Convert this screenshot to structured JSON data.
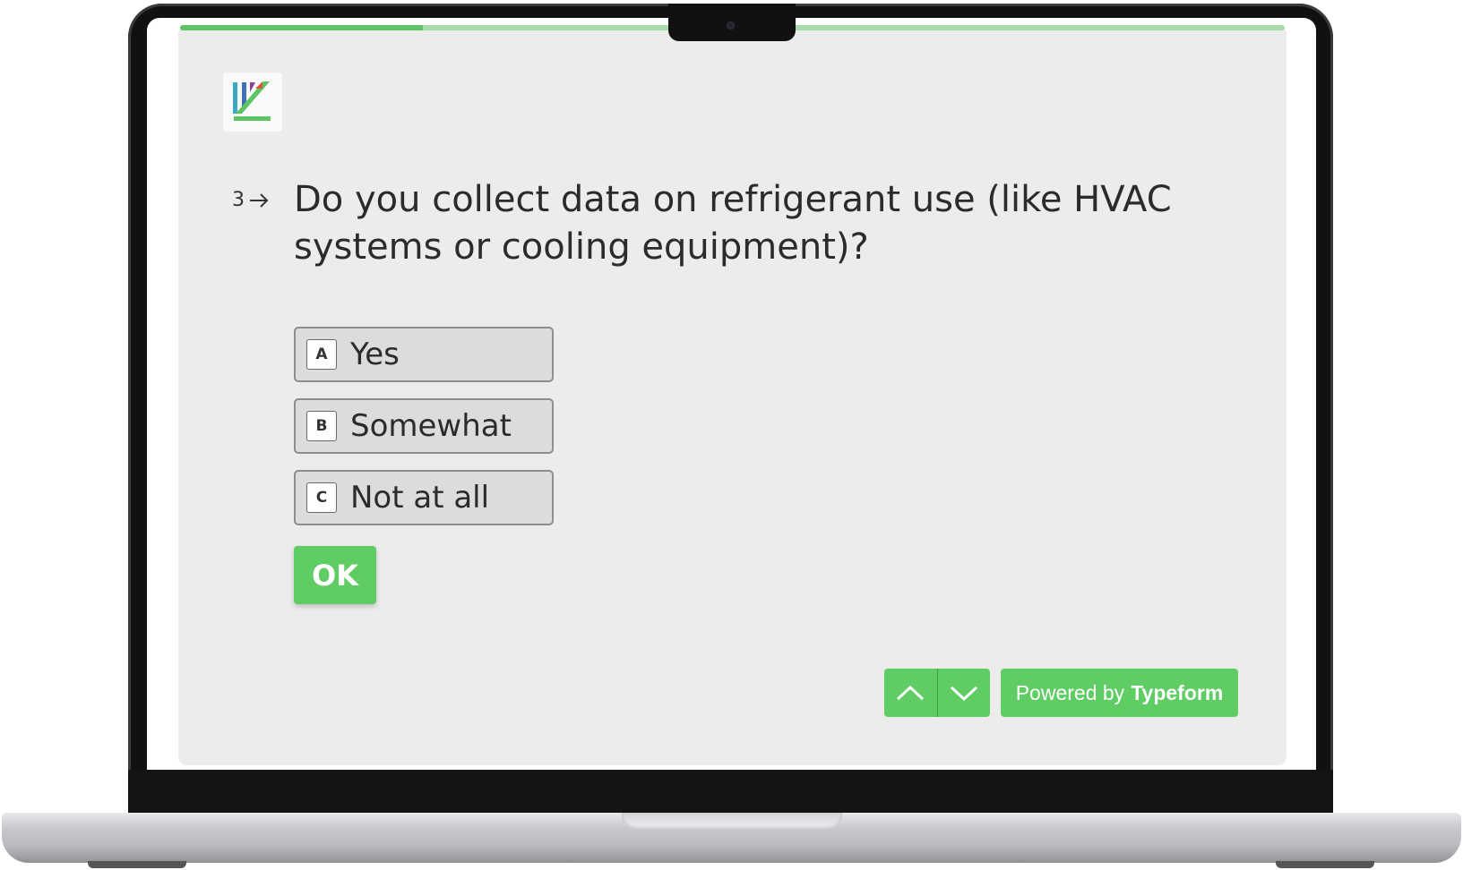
{
  "progress": {
    "value": 0.22
  },
  "question": {
    "number": "3",
    "arrow_icon": "arrow-right-icon",
    "text": "Do you collect data on refrigerant use (like HVAC systems or cooling equipment)?"
  },
  "choices": [
    {
      "key": "A",
      "label": "Yes"
    },
    {
      "key": "B",
      "label": "Somewhat"
    },
    {
      "key": "C",
      "label": "Not at all"
    }
  ],
  "ok_label": "OK",
  "navigation": {
    "up_icon": "chevron-up-icon",
    "down_icon": "chevron-down-icon"
  },
  "powered": {
    "prefix": "Powered by",
    "brand": "Typeform"
  },
  "colors": {
    "accent": "#5fcd63",
    "progress_track": "#a7dba7",
    "background": "#ececec"
  }
}
